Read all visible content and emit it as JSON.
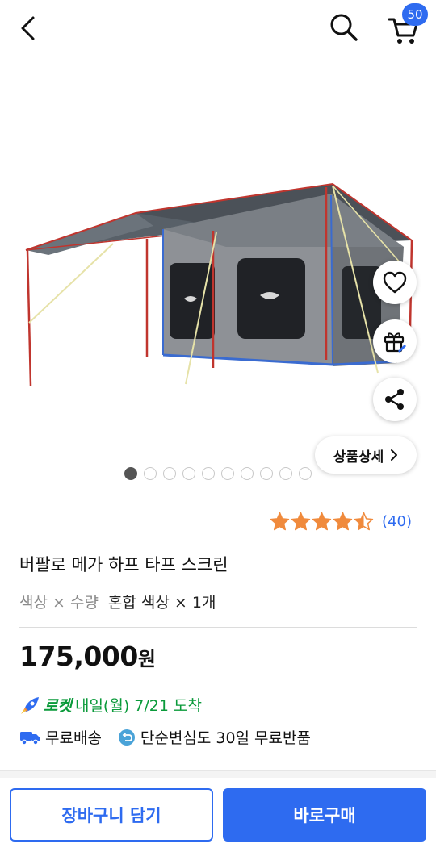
{
  "header": {
    "cart_count": "50",
    "icons": [
      "back-arrow-icon",
      "search-icon",
      "cart-icon"
    ]
  },
  "product_image": {
    "alt": "tent-tarp-screen-photo",
    "gallery_total": 10,
    "gallery_active": 1,
    "actions": [
      "heart-icon",
      "gift-icon",
      "share-icon"
    ],
    "detail_label": "상품상세"
  },
  "rating": {
    "stars": 4.5,
    "review_count": "(40)"
  },
  "product": {
    "title": "버팔로 메가 하프 타프 스크린",
    "option_label": "색상 × 수량",
    "option_value": "혼합 색상 × 1개",
    "price": "175,000",
    "price_unit": "원"
  },
  "delivery": {
    "rocket_brand": "로켓",
    "rocket_text": "내일(월) 7/21 도착",
    "free_shipping": "무료배송",
    "free_return": "단순변심도 30일 무료반품"
  },
  "bottom_bar": {
    "add_to_cart": "장바구니 담기",
    "buy_now": "바로구매"
  },
  "colors": {
    "accent": "#2e6bf0",
    "rocket_green": "#0a9a3a",
    "star": "#f08a3c"
  }
}
